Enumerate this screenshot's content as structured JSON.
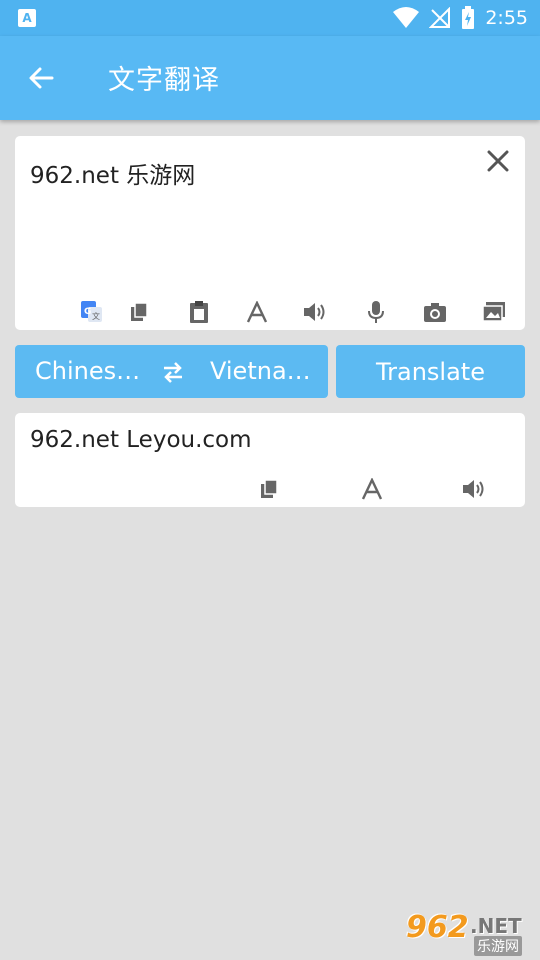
{
  "status_bar": {
    "time": "2:55"
  },
  "app_bar": {
    "title": "文字翻译"
  },
  "input": {
    "text": "962.net 乐游网",
    "tools": [
      "google-translate-icon",
      "copy-icon",
      "paste-icon",
      "font-size-icon",
      "speaker-icon",
      "microphone-icon",
      "camera-icon",
      "gallery-icon"
    ]
  },
  "language": {
    "source": "Chinese (Simplified)",
    "target": "Vietnamese",
    "source_shown": "Chines…",
    "target_shown": "Vietna…"
  },
  "translate_button": {
    "label": "Translate"
  },
  "output": {
    "text": "962.net Leyou.com",
    "tools": [
      "copy-icon",
      "font-size-icon",
      "speaker-icon"
    ]
  },
  "watermark": {
    "number": "962",
    "domain": ".NET",
    "name": "乐游网"
  },
  "colors": {
    "primary": "#58b9f4",
    "button": "#5cbaf2",
    "background": "#e0e0e0"
  }
}
